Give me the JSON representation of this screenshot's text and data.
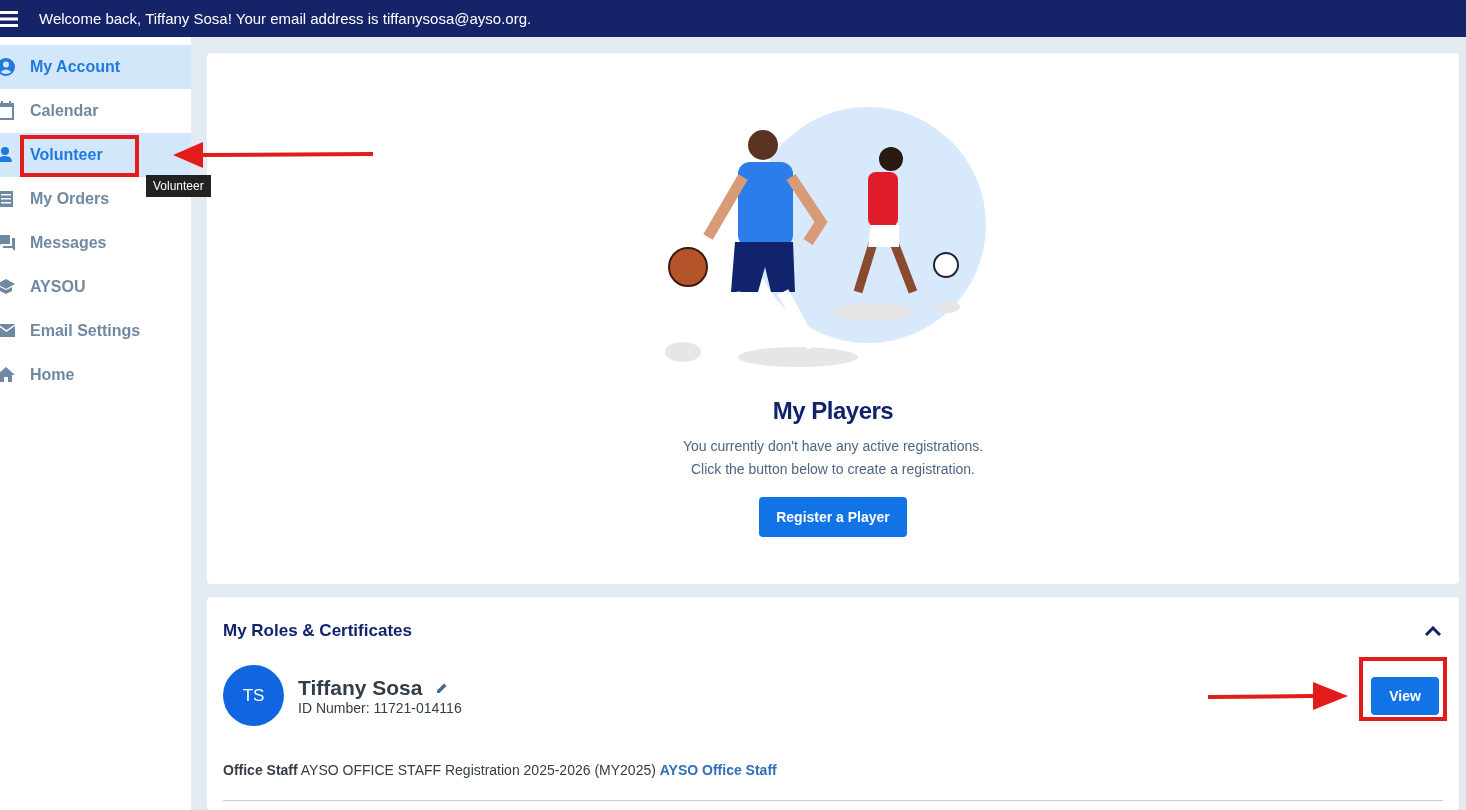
{
  "top_bar": {
    "welcome": "Welcome back, Tiffany Sosa! Your email address is tiffanysosa@ayso.org."
  },
  "sidebar": {
    "items": [
      {
        "kind": "account",
        "label": "My Account",
        "selected": true
      },
      {
        "kind": "calendar",
        "label": "Calendar",
        "selected": false
      },
      {
        "kind": "person",
        "label": "Volunteer",
        "selected": true,
        "tooltip": "Volunteer"
      },
      {
        "kind": "orders",
        "label": "My Orders",
        "selected": false
      },
      {
        "kind": "messages",
        "label": "Messages",
        "selected": false
      },
      {
        "kind": "school",
        "label": "AYSOU",
        "selected": false
      },
      {
        "kind": "mail",
        "label": "Email Settings",
        "selected": false
      },
      {
        "kind": "home",
        "label": "Home",
        "selected": false
      }
    ]
  },
  "players_card": {
    "title": "My Players",
    "message_lines": [
      "You currently don't have any active registrations.",
      "Click the button below to create a registration."
    ],
    "button": "Register a Player"
  },
  "roles_card": {
    "title": "My Roles & Certificates",
    "expanded": true,
    "initials": "TS",
    "name": "Tiffany Sosa",
    "id_number": "ID Number: 11721-014116",
    "view_button": "View",
    "role": {
      "title": "Office Staff",
      "description": "AYSO OFFICE STAFF Registration 2025-2026 (MY2025)",
      "link": "AYSO Office Staff"
    }
  }
}
